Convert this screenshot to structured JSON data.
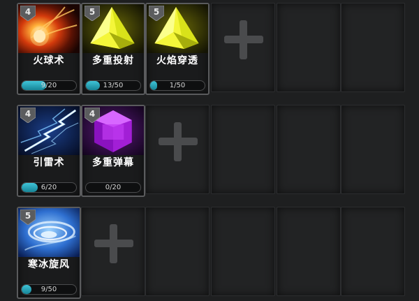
{
  "rows": [
    {
      "skills": [
        {
          "name": "火球术",
          "level": "4",
          "progress_text": "9/20",
          "progress": 0.45,
          "icon": "fireball-icon"
        },
        {
          "name": "多重投射",
          "level": "5",
          "progress_text": "13/50",
          "progress": 0.26,
          "icon": "yellow-crystal-icon"
        },
        {
          "name": "火焰穿透",
          "level": "5",
          "progress_text": "1/50",
          "progress": 0.02,
          "icon": "yellow-crystal-icon"
        }
      ],
      "add_slot": 3,
      "empty_slots": 3
    },
    {
      "skills": [
        {
          "name": "引雷术",
          "level": "4",
          "progress_text": "6/20",
          "progress": 0.3,
          "icon": "lightning-icon"
        },
        {
          "name": "多重弹幕",
          "level": "4",
          "progress_text": "0/20",
          "progress": 0.0,
          "icon": "purple-gem-icon"
        }
      ],
      "add_slot": 2,
      "empty_slots": 4
    },
    {
      "skills": [
        {
          "name": "寒冰旋风",
          "level": "5",
          "progress_text": "9/50",
          "progress": 0.18,
          "icon": "ice-whirlwind-icon"
        }
      ],
      "add_slot": 1,
      "empty_slots": 5
    }
  ],
  "colors": {
    "progress_fill": "#2fb3c8",
    "background": "#1e1f20",
    "slot": "#222324"
  }
}
